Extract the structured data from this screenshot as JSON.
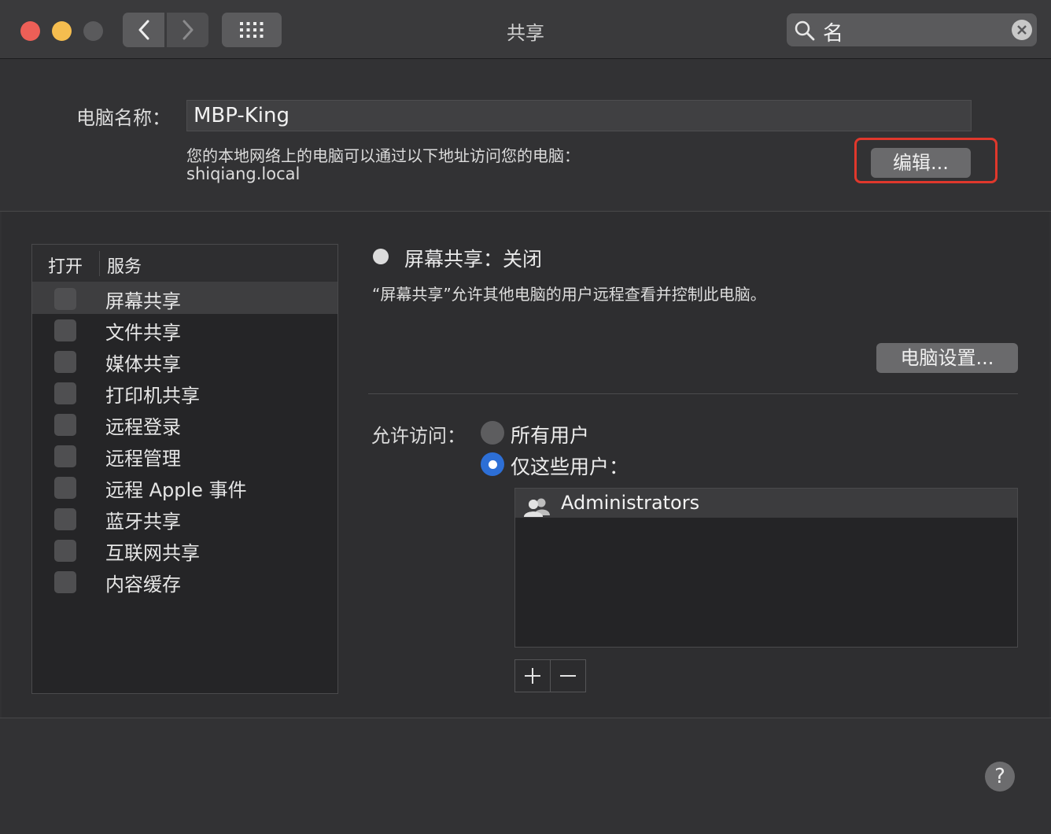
{
  "window": {
    "title": "共享",
    "search": {
      "value": "名"
    }
  },
  "computer_name": {
    "label": "电脑名称：",
    "value": "MBP-King",
    "description": "您的本地网络上的电脑可以通过以下地址访问您的电脑：",
    "hostname": "shiqiang.local",
    "edit_button": "编辑..."
  },
  "services": {
    "header_on": "打开",
    "header_service": "服务",
    "items": [
      {
        "label": "屏幕共享",
        "checked": false,
        "selected": true
      },
      {
        "label": "文件共享",
        "checked": false
      },
      {
        "label": "媒体共享",
        "checked": false
      },
      {
        "label": "打印机共享",
        "checked": false
      },
      {
        "label": "远程登录",
        "checked": false
      },
      {
        "label": "远程管理",
        "checked": false
      },
      {
        "label": "远程 Apple 事件",
        "checked": false
      },
      {
        "label": "蓝牙共享",
        "checked": false
      },
      {
        "label": "互联网共享",
        "checked": false
      },
      {
        "label": "内容缓存",
        "checked": false
      }
    ]
  },
  "detail": {
    "status": "屏幕共享：关闭",
    "description": "“屏幕共享”允许其他电脑的用户远程查看并控制此电脑。",
    "computer_settings_button": "电脑设置...",
    "access_label": "允许访问：",
    "access_options": [
      {
        "label": "所有用户",
        "selected": false
      },
      {
        "label": "仅这些用户：",
        "selected": true
      }
    ],
    "users": [
      {
        "name": "Administrators",
        "icon": "group-icon"
      }
    ],
    "add_label": "+",
    "remove_label": "−"
  },
  "help_label": "?",
  "colors": {
    "accent": "#2d6fd6",
    "highlight_box": "#e0382c"
  }
}
